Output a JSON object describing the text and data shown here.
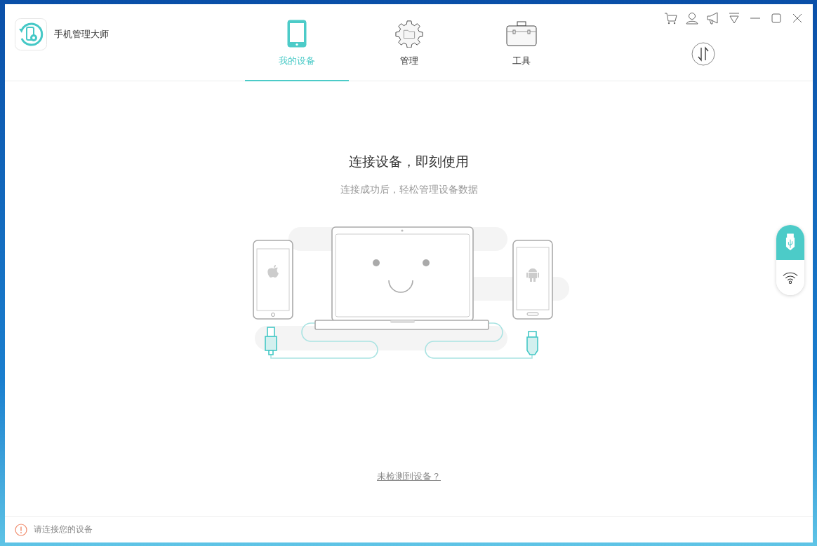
{
  "app": {
    "title": "手机管理大师"
  },
  "tabs": [
    {
      "label": "我的设备",
      "kind": "phone",
      "selected": true
    },
    {
      "label": "管理",
      "kind": "gear",
      "selected": false
    },
    {
      "label": "工具",
      "kind": "toolbox",
      "selected": false
    }
  ],
  "main": {
    "heading": "连接设备，即刻使用",
    "subheading": "连接成功后，轻松管理设备数据",
    "help_link": "未检测到设备？"
  },
  "connection_modes": [
    {
      "kind": "usb",
      "selected": true
    },
    {
      "kind": "wifi",
      "selected": false
    }
  ],
  "status_bar": {
    "message": "请连接您的设备"
  }
}
